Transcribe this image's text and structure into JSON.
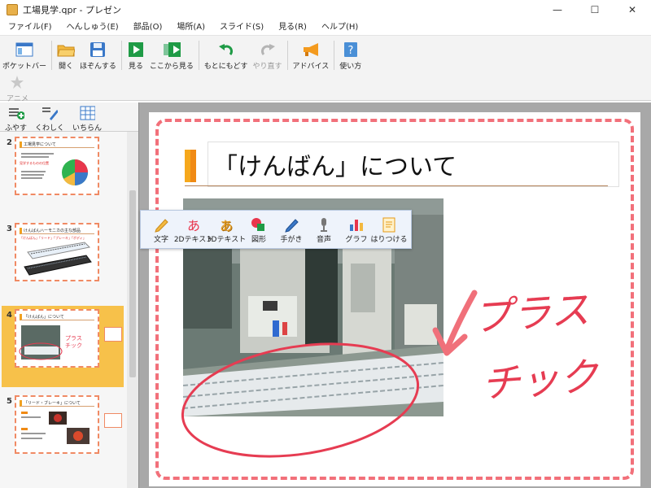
{
  "window": {
    "title": "工場見学.qpr - プレゼン",
    "minimize_glyph": "—",
    "maximize_glyph": "☐",
    "close_glyph": "✕"
  },
  "menu": {
    "file": "ファイル(F)",
    "edit": "へんしゅう(E)",
    "parts": "部品(O)",
    "place": "場所(A)",
    "slide": "スライド(S)",
    "view": "見る(R)",
    "help": "ヘルプ(H)"
  },
  "toolbar": {
    "pocket_bar": "ポケットバー",
    "open": "開く",
    "save": "ほぞんする",
    "show": "見る",
    "show_from_here": "ここから見る",
    "undo": "もとにもどす",
    "redo": "やり直す",
    "advice": "アドバイス",
    "howto": "使い方",
    "anime": "アニメ"
  },
  "panel_toolbar": {
    "add": "ふやす",
    "detail": "くわしく",
    "list": "いちらん"
  },
  "slides": [
    {
      "number": "2",
      "title": "工場見学について",
      "subtitle": "見学するものの位置"
    },
    {
      "number": "3",
      "title": "けんばんハーモニカの主な部品",
      "subtitle": "「けんばん」「リード」「ブレーキ」「ボディ」"
    },
    {
      "number": "4",
      "title": "「けんばん」について",
      "annotation": "プラス チック"
    },
    {
      "number": "5",
      "title": "「リード・ブレーキ」について"
    }
  ],
  "slide": {
    "title": "「けんばん」について",
    "handwriting_line1": "プラス",
    "handwriting_line2": "チック"
  },
  "floatbar": {
    "text": "文字",
    "text_2d": "2Dテキスト",
    "text_3d": "3Dテキスト",
    "shape": "図形",
    "handwriting": "手がき",
    "sound": "音声",
    "graph": "グラフ",
    "paste": "はりつける"
  },
  "colors": {
    "slide_border": "#f2707a",
    "title_bar": "#f6a81c",
    "selected_slide": "#f7c14a",
    "handwriting": "#e63c52",
    "canvas_bg": "#a8a8a8"
  }
}
